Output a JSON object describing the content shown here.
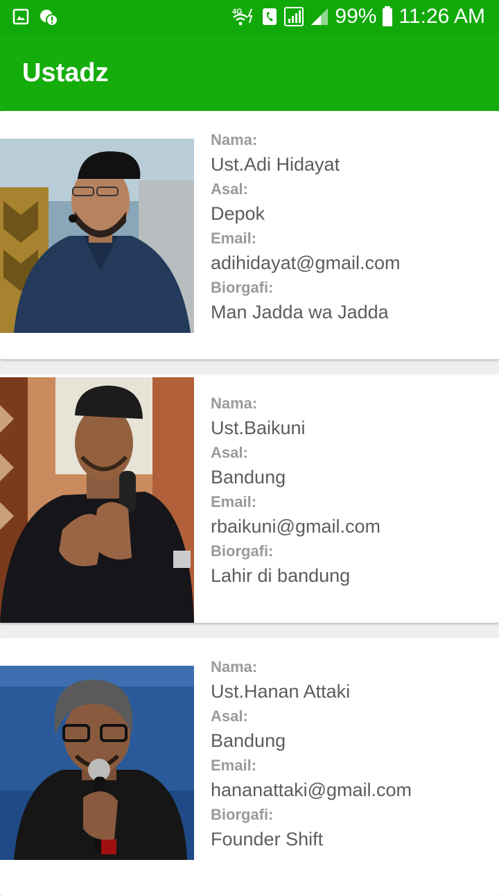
{
  "status_bar": {
    "battery": "99%",
    "time": "11:26 AM",
    "network": "4G"
  },
  "app_bar": {
    "title": "Ustadz"
  },
  "labels": {
    "nama": "Nama:",
    "asal": "Asal:",
    "email": "Email:",
    "biografi": "Biorgafi:"
  },
  "ustadz": [
    {
      "nama": "Ust.Adi Hidayat",
      "asal": "Depok",
      "email": "adihidayat@gmail.com",
      "biografi": "Man Jadda wa Jadda"
    },
    {
      "nama": "Ust.Baikuni",
      "asal": "Bandung",
      "email": "rbaikuni@gmail.com",
      "biografi": "Lahir di bandung"
    },
    {
      "nama": "Ust.Hanan Attaki",
      "asal": "Bandung",
      "email": "hananattaki@gmail.com",
      "biografi": "Founder Shift"
    }
  ],
  "colors": {
    "primary": "#15ad0b",
    "status": "#11a90a"
  }
}
